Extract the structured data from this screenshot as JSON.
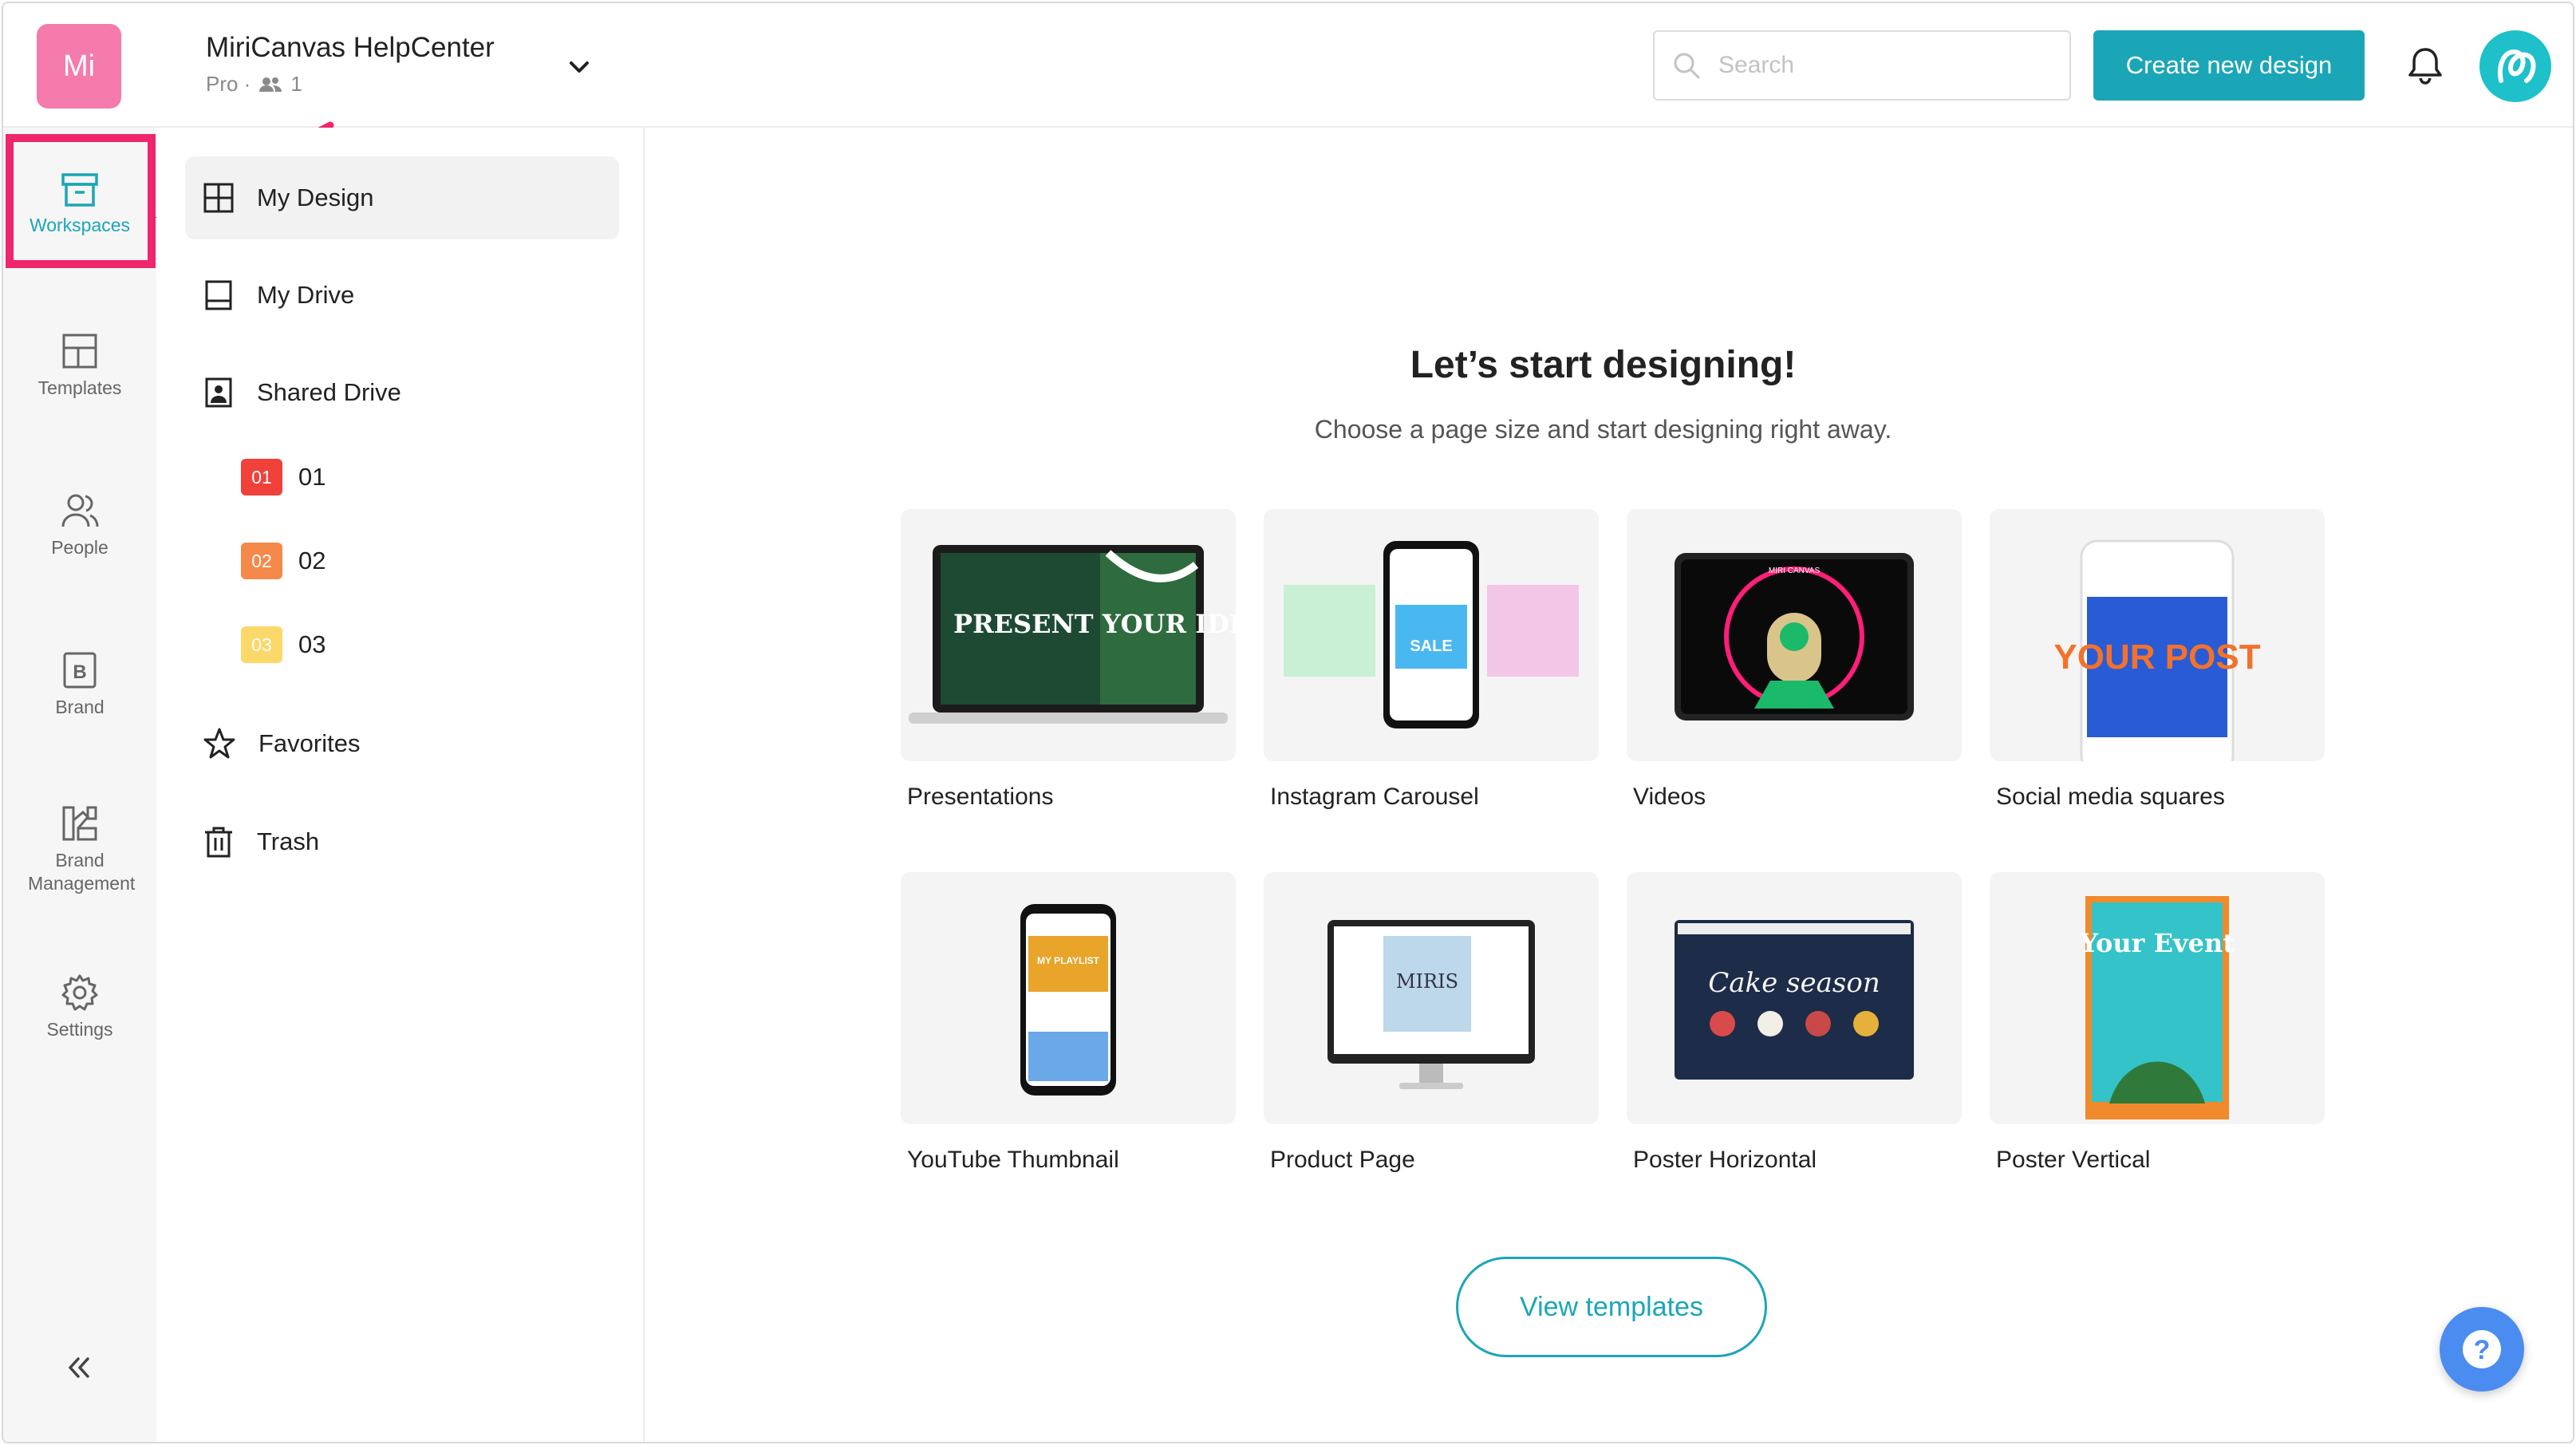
{
  "header": {
    "logo_text": "Mi",
    "workspace_name": "MiriCanvas HelpCenter",
    "workspace_plan": "Pro ·",
    "member_count": "1",
    "search_placeholder": "Search",
    "create_button": "Create new design"
  },
  "rail": {
    "items": [
      {
        "label": "Workspaces",
        "icon": "archive-icon",
        "active": true
      },
      {
        "label": "Templates",
        "icon": "layout-icon"
      },
      {
        "label": "People",
        "icon": "people-icon"
      },
      {
        "label": "Brand",
        "icon": "brand-b-icon"
      },
      {
        "label": "Brand Management",
        "icon": "brand-management-icon"
      },
      {
        "label": "Settings",
        "icon": "gear-icon"
      }
    ]
  },
  "sidebar": {
    "items": [
      {
        "label": "My Design",
        "icon": "grid-icon"
      },
      {
        "label": "My Drive",
        "icon": "drive-icon"
      },
      {
        "label": "Shared Drive",
        "icon": "shared-drive-icon"
      },
      {
        "label": "Favorites",
        "icon": "star-icon"
      },
      {
        "label": "Trash",
        "icon": "trash-icon"
      }
    ],
    "shared_folders": [
      {
        "badge": "01",
        "label": "01",
        "color": "#f0413a"
      },
      {
        "badge": "02",
        "label": "02",
        "color": "#f5894a"
      },
      {
        "badge": "03",
        "label": "03",
        "color": "#fbd86a"
      }
    ]
  },
  "main": {
    "headline": "Let’s start designing!",
    "subhead": "Choose a page size and start designing right away.",
    "cards": [
      {
        "label": "Presentations",
        "thumb_text": "PRESENT YOUR IDEAS"
      },
      {
        "label": "Instagram Carousel",
        "thumb_text": "SALE"
      },
      {
        "label": "Videos",
        "thumb_text": "MIRI CANVAS"
      },
      {
        "label": "Social media squares",
        "thumb_text": "YOUR POST"
      },
      {
        "label": "YouTube Thumbnail",
        "thumb_text": "MY PLAYLIST"
      },
      {
        "label": "Product Page",
        "thumb_text": "MIRIS"
      },
      {
        "label": "Poster Horizontal",
        "thumb_text": "Cake season"
      },
      {
        "label": "Poster Vertical",
        "thumb_text": "Your Event"
      }
    ],
    "view_templates": "View templates"
  },
  "colors": {
    "accent": "#1ba6b8",
    "highlight": "#f0266d",
    "logo": "#f47bac"
  }
}
